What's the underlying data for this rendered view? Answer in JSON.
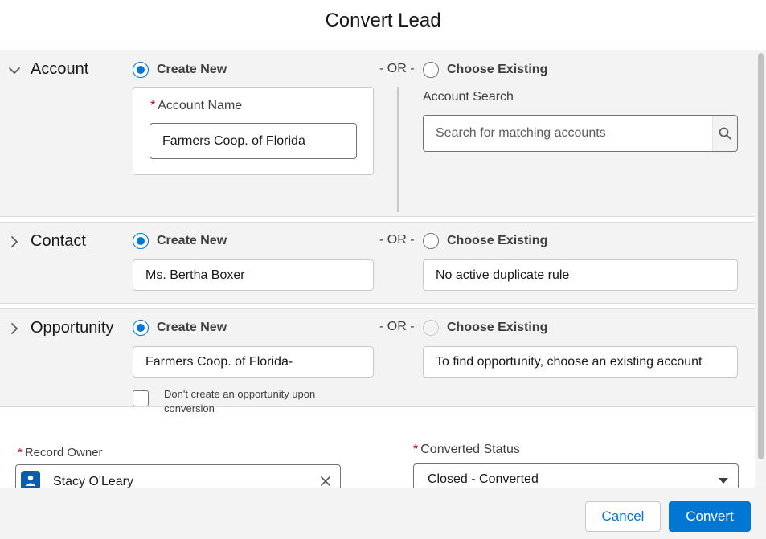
{
  "modal": {
    "title": "Convert Lead"
  },
  "common": {
    "create_new": "Create New",
    "or": "- OR -",
    "choose_existing": "Choose Existing"
  },
  "account": {
    "title": "Account",
    "name_label": "Account Name",
    "name_value": "Farmers Coop. of Florida",
    "search_label": "Account Search",
    "search_placeholder": "Search for matching accounts"
  },
  "contact": {
    "title": "Contact",
    "name_value": "Ms. Bertha Boxer",
    "existing_value": "No active duplicate rule"
  },
  "opportunity": {
    "title": "Opportunity",
    "name_value": "Farmers Coop. of Florida-",
    "existing_value": "To find opportunity, choose an existing account",
    "no_create_label": "Don't create an opportunity upon conversion"
  },
  "owner": {
    "label": "Record Owner",
    "value": "Stacy O'Leary"
  },
  "status": {
    "label": "Converted Status",
    "value": "Closed - Converted"
  },
  "footer": {
    "cancel_label": "Cancel",
    "convert_label": "Convert"
  },
  "colors": {
    "brand": "#0176d3",
    "required": "#ba0517",
    "section_bg": "#f3f3f3"
  }
}
